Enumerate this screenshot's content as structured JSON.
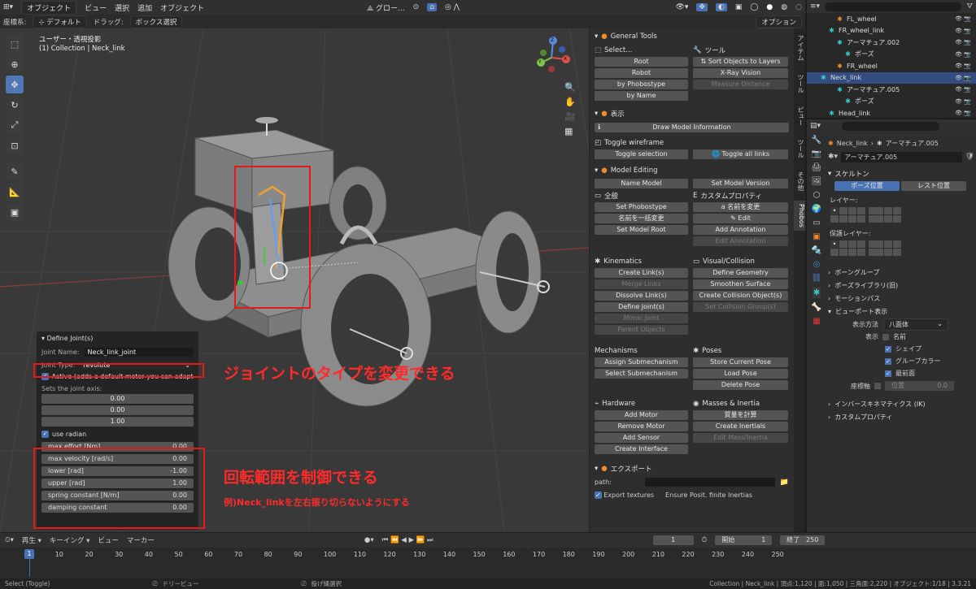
{
  "menu": {
    "items": [
      "オブジェクト",
      "ビュー",
      "選択",
      "追加",
      "オブジェクト"
    ],
    "mode_dropdown": "オブジェクト",
    "view_menu": "グロー..."
  },
  "toolbar2": {
    "coord_label": "座標系:",
    "coord_value": "デフォルト",
    "drag_label": "ドラッグ:",
    "drag_value": "ボックス選択",
    "options": "オプション"
  },
  "viewport": {
    "title": "ユーザー・透視投影",
    "subtitle": "(1) Collection | Neck_link",
    "gizmo": {
      "x": "X",
      "y": "Y",
      "z": "Z"
    }
  },
  "define_joint": {
    "header": "Define Joint(s)",
    "name_label": "Joint Name:",
    "name_value": "Neck_link_joint",
    "type_label": "Joint Type:",
    "type_value": "revolute",
    "active_label": "Active (adds a default motor you can adapt ...",
    "axis_label": "Sets the joint axis:",
    "axis": [
      "0.00",
      "0.00",
      "1.00"
    ],
    "radian_label": "use radian",
    "fields": [
      {
        "label": "max effort [Nm]",
        "value": "0.00"
      },
      {
        "label": "max velocity [rad/s]",
        "value": "0.00"
      },
      {
        "label": "lower [rad]",
        "value": "-1.00"
      },
      {
        "label": "upper [rad]",
        "value": "1.00"
      },
      {
        "label": "spring constant [N/m]",
        "value": "0.00"
      },
      {
        "label": "damping constant",
        "value": "0.00"
      }
    ]
  },
  "annotations": {
    "joint_type": "ジョイントのタイプを変更できる",
    "range": "回転範囲を制御できる",
    "example": "例)Neck_linkを左右振り切らないようにする"
  },
  "phobos": {
    "general": "General Tools",
    "select": "Select...",
    "tools": "ツール",
    "select_btns": [
      "Root",
      "Robot",
      "by Phobostype",
      "by Name"
    ],
    "tool_btns": [
      "Sort Objects to Layers",
      "X-Ray Vision",
      "Measure Distance"
    ],
    "display": "表示",
    "draw_info": "Draw Model Information",
    "toggle_wire": "Toggle wireframe",
    "toggle_sel": "Toggle selection",
    "toggle_all": "Toggle all links",
    "model_editing": "Model Editing",
    "name_model": "Name Model",
    "set_version": "Set Model Version",
    "general_lbl": "全般",
    "custom_props": "カスタムプロパティ",
    "general_btns": [
      "Set Phobostype",
      "名前を一括変更",
      "Set Model Root"
    ],
    "custom_btns": [
      "名前を変更",
      "Edit",
      "Add Annotation",
      "Edit Annotation"
    ],
    "kinematics": "Kinematics",
    "visual": "Visual/Collision",
    "kin_btns": [
      "Create Link(s)",
      "Merge Links",
      "Dissolve Link(s)",
      "Define Joint(s)",
      "Mimic Joint",
      "Parent Objects"
    ],
    "vis_btns": [
      "Define Geometry",
      "Smoothen Surface",
      "Create Collision Object(s)",
      "Set Collision Group(s)"
    ],
    "mechanisms": "Mechanisms",
    "poses": "Poses",
    "mech_btns": [
      "Assign Submechanism",
      "Select Submechanism"
    ],
    "pose_btns": [
      "Store Current Pose",
      "Load Pose",
      "Delete Pose"
    ],
    "hardware": "Hardware",
    "masses": "Masses & Inertia",
    "hw_btns": [
      "Add Motor",
      "Remove Motor",
      "Add Sensor",
      "Create Interface"
    ],
    "mass_btns": [
      "質量を計算",
      "Create Inertials",
      "Edit Mass/Inertia"
    ],
    "export": "エクスポート",
    "path": "path:",
    "export_tex": "Export textures",
    "ensure": "Ensure Posit. finite Inertias"
  },
  "vtabs": [
    "アイテム",
    "ツール",
    "ビュー",
    "ツール",
    "その他",
    "Phobos"
  ],
  "outliner": {
    "rows": [
      {
        "name": "FL_wheel",
        "indent": 3
      },
      {
        "name": "FR_wheel_link",
        "indent": 2
      },
      {
        "name": "アーマチュア.002",
        "indent": 3
      },
      {
        "name": "ポーズ",
        "indent": 4
      },
      {
        "name": "FR_wheel",
        "indent": 3
      },
      {
        "name": "Neck_link",
        "indent": 1
      },
      {
        "name": "アーマチュア.005",
        "indent": 3
      },
      {
        "name": "ポーズ",
        "indent": 4
      },
      {
        "name": "Head_link",
        "indent": 2
      }
    ]
  },
  "props": {
    "breadcrumb1": "Neck_link",
    "breadcrumb2": "アーマチュア.005",
    "data_name": "アーマチュア.005",
    "skeleton": "スケルトン",
    "pose_pos": "ポーズ位置",
    "rest_pos": "レスト位置",
    "layer": "レイヤー:",
    "protect_layer": "保護レイヤー:",
    "sections": [
      "ボーングループ",
      "ポーズライブラリ(旧)",
      "モーションパス"
    ],
    "viewport_disp": "ビューポート表示",
    "disp_method_label": "表示方法",
    "disp_method": "八面体",
    "display_label": "表示",
    "checks": [
      "名前",
      "シェイプ",
      "グループカラー",
      "最前面"
    ],
    "axes_label": "座標軸",
    "position": "位置",
    "position_val": "0.0",
    "ik": "インバースキネマティクス (IK)",
    "custom": "カスタムプロパティ"
  },
  "timeline": {
    "playback": "再生",
    "keying": "キーイング",
    "view": "ビュー",
    "marker": "マーカー",
    "frame": "1",
    "start_label": "開始",
    "start": "1",
    "end_label": "終了",
    "end": "250",
    "ticks": [
      "1",
      "10",
      "20",
      "30",
      "40",
      "50",
      "60",
      "70",
      "80",
      "90",
      "100",
      "110",
      "120",
      "130",
      "140",
      "150",
      "160",
      "170",
      "180",
      "190",
      "200",
      "210",
      "220",
      "230",
      "240",
      "250"
    ]
  },
  "status": {
    "select": "Select (Toggle)",
    "dolly": "ドリービュー",
    "lasso": "投げ縄選択",
    "info": "Collection | Neck_link | 頂点:1,120 | 面:1,050 | 三角面:2,220 | オブジェクト:1/18 | 3.3.21"
  }
}
